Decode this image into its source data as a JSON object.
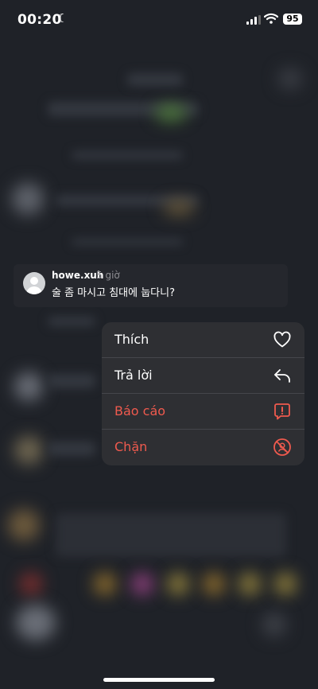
{
  "status_bar": {
    "time": "00:20",
    "battery": "95"
  },
  "comment": {
    "username": "howe.xuh",
    "time_ago": "5 giờ",
    "text": "술 좀 마시고 침대에 눕다니?"
  },
  "menu": {
    "items": [
      {
        "label": "Thích",
        "icon": "heart-icon",
        "destructive": false
      },
      {
        "label": "Trả lời",
        "icon": "reply-icon",
        "destructive": false
      },
      {
        "label": "Báo cáo",
        "icon": "report-icon",
        "destructive": true
      },
      {
        "label": "Chặn",
        "icon": "block-icon",
        "destructive": true
      }
    ]
  },
  "colors": {
    "destructive": "#ef5a4e",
    "menu_bg": "#2e2f33",
    "background": "#1f2228"
  }
}
